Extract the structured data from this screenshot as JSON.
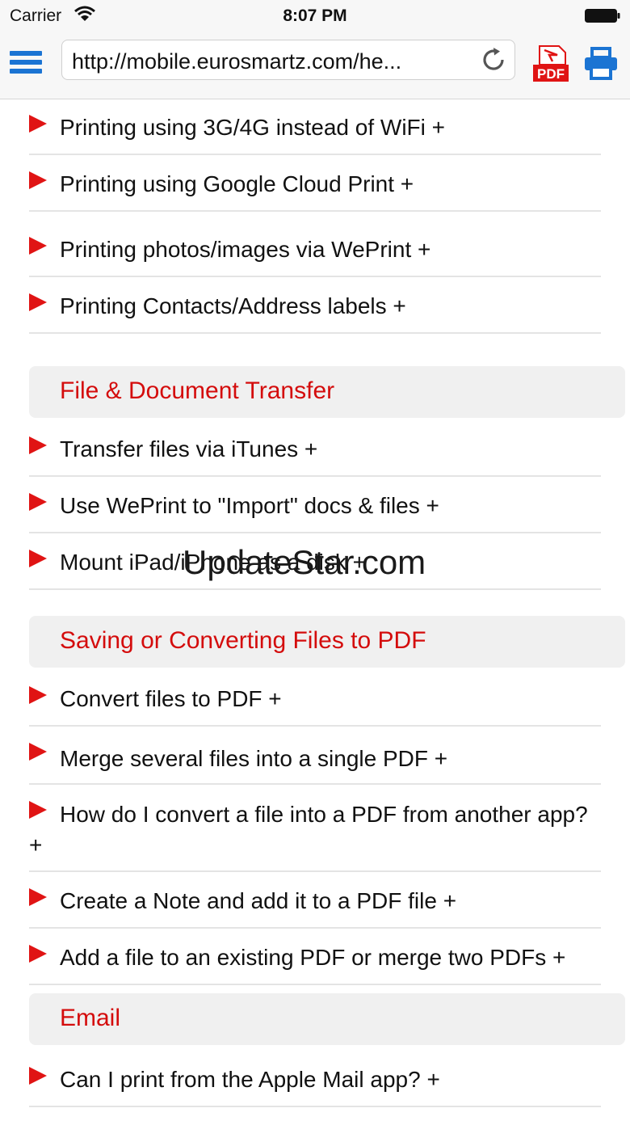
{
  "status_bar": {
    "carrier": "Carrier",
    "time": "8:07 PM"
  },
  "toolbar": {
    "url": "http://mobile.eurosmartz.com/he...",
    "pdf_icon_text": "PDF"
  },
  "items": [
    {
      "label": "Printing using 3G/4G instead of WiFi +"
    },
    {
      "label": "Printing using Google Cloud Print +"
    },
    {
      "label": "Printing photos/images via WePrint +"
    },
    {
      "label": "Printing Contacts/Address labels +"
    },
    {
      "label": "Transfer files via iTunes +"
    },
    {
      "label": "Use WePrint to \"Import\" docs & files +"
    },
    {
      "label": "Mount iPad/iPhone as a disk +"
    },
    {
      "label": "Convert files to PDF +"
    },
    {
      "label": "Merge several files into a single PDF +"
    },
    {
      "label": "How do I convert a file into a PDF from another app? +"
    },
    {
      "label": "Create a Note and add it to a PDF file +"
    },
    {
      "label": "Add a file to an existing PDF or merge two PDFs +"
    },
    {
      "label": "Can I print from the Apple Mail app? +"
    }
  ],
  "sections": [
    {
      "title": "File & Document Transfer"
    },
    {
      "title": "Saving or Converting Files to PDF"
    },
    {
      "title": "Email"
    }
  ],
  "watermark": "UpdateStar.com",
  "colors": {
    "accent": "#1b74d3",
    "heading": "#d40c0c",
    "arrow": "#e01414"
  }
}
